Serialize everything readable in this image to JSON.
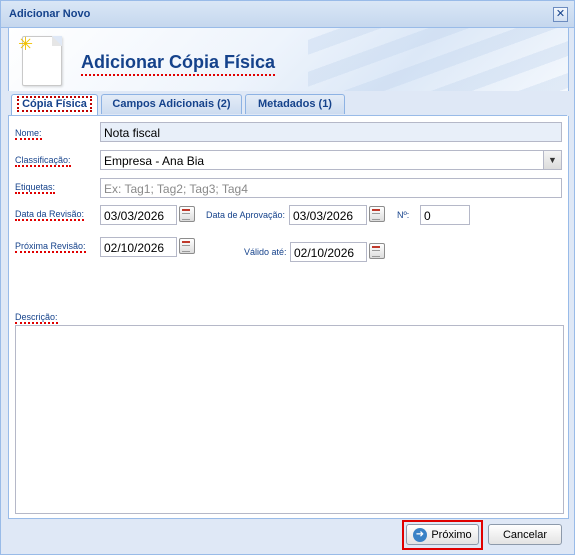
{
  "window": {
    "title": "Adicionar Novo",
    "close_glyph": "✕"
  },
  "header": {
    "title": "Adicionar Cópia Física",
    "icon": "document-new-icon"
  },
  "tabs": [
    {
      "label": "Cópia Física"
    },
    {
      "label": "Campos Adicionais (2)"
    },
    {
      "label": "Metadados (1)"
    }
  ],
  "form": {
    "nome": {
      "label": "Nome:",
      "value": "Nota fiscal"
    },
    "classificacao": {
      "label": "Classificação:",
      "value": "Empresa - Ana Bia"
    },
    "etiquetas": {
      "label": "Etiquetas:",
      "placeholder": "Ex: Tag1; Tag2; Tag3; Tag4"
    },
    "data_revisao": {
      "label": "Data da Revisão:",
      "value": "03/03/2026"
    },
    "data_aprovacao": {
      "label": "Data de Aprovação:",
      "value": "03/03/2026"
    },
    "numero": {
      "label": "Nº:",
      "value": "0"
    },
    "proxima_revisao": {
      "label": "Próxima Revisão:",
      "value": "02/10/2026"
    },
    "valido_ate": {
      "label": "Válido até:",
      "value": "02/10/2026"
    },
    "descricao": {
      "label": "Descrição:",
      "value": ""
    }
  },
  "footer": {
    "next_label": "Próximo",
    "cancel_label": "Cancelar"
  },
  "colors": {
    "accent": "#15428b",
    "border": "#99bbe8",
    "highlight": "#e00000"
  }
}
